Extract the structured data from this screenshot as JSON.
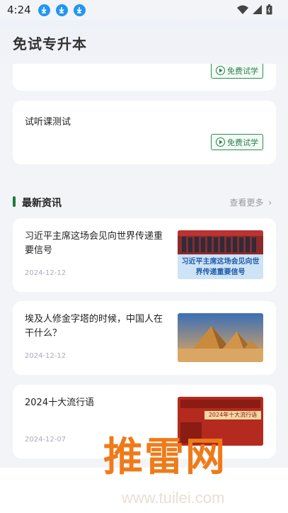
{
  "status": {
    "time": "4:24"
  },
  "header": {
    "title": "免试专升本"
  },
  "courses": [
    {
      "title": "",
      "button": "免费试学"
    },
    {
      "title": "试听课测试",
      "button": "免费试学"
    }
  ],
  "news_section": {
    "title": "最新资讯",
    "more": "查看更多"
  },
  "news": [
    {
      "title": "习近平主席这场会见向世界传递重要信号",
      "date": "2024-12-12",
      "thumb_caption": "习近平主席这场会见向世界传递重要信号"
    },
    {
      "title": "埃及人修金字塔的时候，中国人在干什么？",
      "date": "2024-12-12"
    },
    {
      "title": "2024十大流行语",
      "date": "2024-12-07",
      "thumb_caption": "2024年十大流行语"
    }
  ],
  "watermark": {
    "brand": "推雷网",
    "url": "www.tuilei.com"
  },
  "colors": {
    "accent": "#1f7a3c",
    "card": "#ffffff",
    "background": "#f3f4f8",
    "watermark": "#f07a18"
  }
}
